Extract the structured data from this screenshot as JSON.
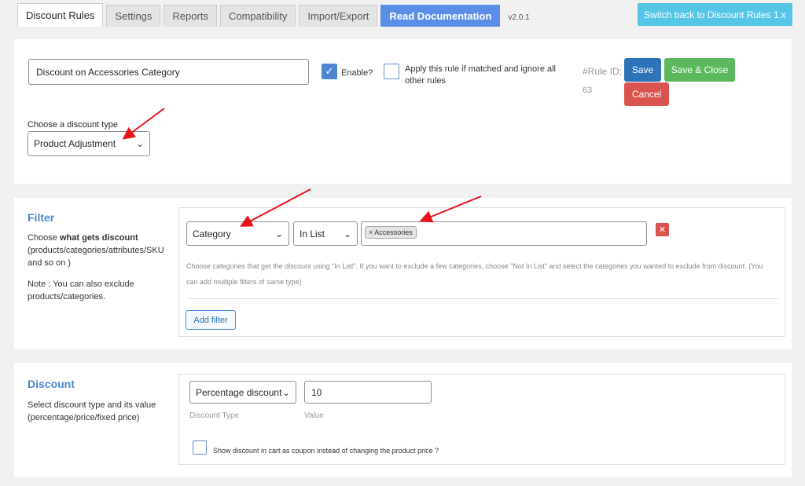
{
  "tabs": [
    "Discount Rules",
    "Settings",
    "Reports",
    "Compatibility",
    "Import/Export",
    "Read Documentation"
  ],
  "version": "v2.0.1",
  "switch_button": "Switch back to Discount Rules 1.x",
  "rule": {
    "name_value": "Discount on Accessories Category",
    "enable_label": "Enable?",
    "apply_label": "Apply this rule if matched and ignore all other rules",
    "rule_id_label": "#Rule ID:",
    "rule_id_value": "63",
    "save": "Save",
    "save_close": "Save & Close",
    "cancel": "Cancel",
    "discount_type_label": "Choose a discount type",
    "discount_type_value": "Product Adjustment"
  },
  "filter": {
    "title": "Filter",
    "desc_prefix": "Choose ",
    "desc_bold": "what gets discount",
    "desc_rest": "(products/categories/attributes/SKU and so on )",
    "note": "Note : You can also exclude products/categories.",
    "type_value": "Category",
    "operator_value": "In List",
    "chip": "× Accessories",
    "delete": "✕",
    "help": "Choose categories that get the discount using \"In List\". If you want to exclude a few categories, choose \"Not In List\" and select the categories you wanted to exclude from discount. (You can add multiple filters of same type)",
    "add_filter": "Add filter"
  },
  "discount": {
    "title": "Discount",
    "desc": "Select discount type and its value (percentage/price/fixed price)",
    "type_value": "Percentage discount",
    "value": "10",
    "type_caption": "Discount Type",
    "value_caption": "Value",
    "coupon_label": "Show discount in cart as coupon instead of changing the product price ?"
  },
  "colors": {
    "accent": "#4f86d1",
    "save": "#2c73b7",
    "save_close": "#5cb85c",
    "cancel": "#d9534f",
    "switch": "#55c6e6",
    "arrow": "#e8141a"
  },
  "icons": [
    "checkmark-icon",
    "chevron-down-icon",
    "close-icon",
    "arrow-annotation"
  ]
}
